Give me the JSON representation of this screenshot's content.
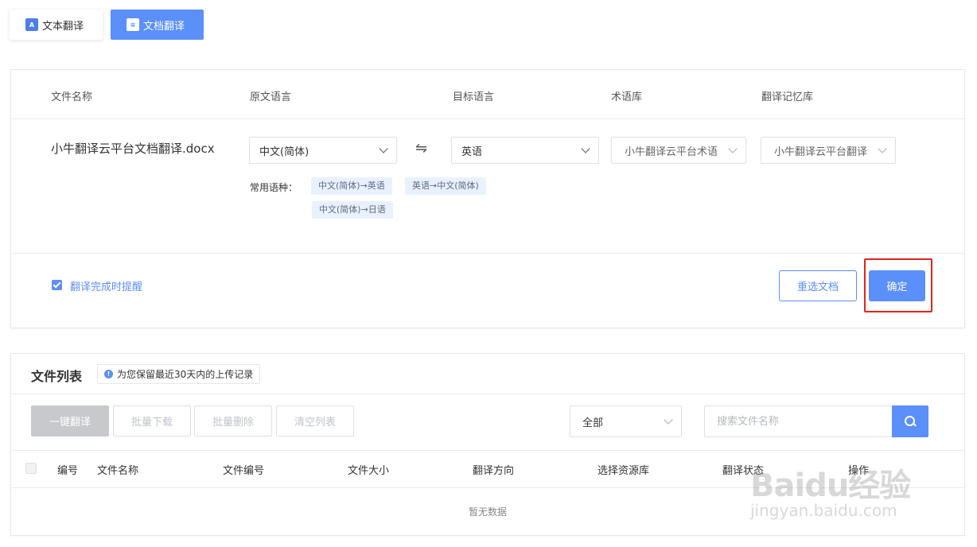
{
  "tabs": {
    "text_translate": {
      "label": "文本翻译",
      "icon": "text-translate-icon"
    },
    "doc_translate": {
      "label": "文档翻译",
      "icon": "document-icon"
    }
  },
  "upload": {
    "headers": {
      "file_name": "文件名称",
      "source_lang": "原文语言",
      "target_lang": "目标语言",
      "glossary": "术语库",
      "memory": "翻译记忆库"
    },
    "file_name": "小牛翻译云平台文档翻译.docx",
    "source_lang": "中文(简体)",
    "target_lang": "英语",
    "swap_icon": "⇋",
    "glossary": "小牛翻译云平台术语",
    "memory": "小牛翻译云平台翻译",
    "common_label": "常用语种：",
    "common_pairs": [
      "中文(简体)→英语",
      "英语→中文(简体)",
      "中文(简体)→日语"
    ],
    "remind_label": "翻译完成时提醒",
    "remind_checked": true,
    "reselect_label": "重选文档",
    "confirm_label": "确定"
  },
  "file_list": {
    "title": "文件列表",
    "notice": "为您保留最近30天内的上传记录",
    "toolbar": {
      "translate_all": "一键翻译",
      "batch_download": "批量下载",
      "batch_delete": "批量删除",
      "clear_list": "清空列表"
    },
    "filter": "全部",
    "search_placeholder": "搜索文件名称",
    "columns": [
      "编号",
      "文件名称",
      "文件编号",
      "文件大小",
      "翻译方向",
      "选择资源库",
      "翻译状态",
      "操作"
    ],
    "empty_text": "暂无数据"
  },
  "watermark": {
    "brand": "Baidu经验",
    "url": "jingyan.baidu.com"
  },
  "colors": {
    "accent": "#5b8ff9",
    "highlight": "#e0241c",
    "disabled": "#c8c9cc"
  }
}
